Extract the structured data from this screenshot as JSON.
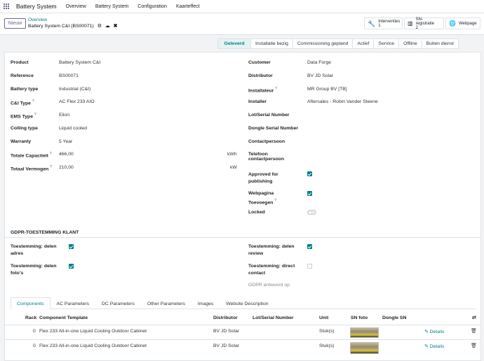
{
  "topbar": {
    "brand": "Battery System",
    "menu": [
      "Overview",
      "Battery System",
      "Configuration",
      "Kaarteffect"
    ]
  },
  "control": {
    "new_label": "Nieuw",
    "breadcrumb": "Overview",
    "record": "Battery System C&I (BS00071)"
  },
  "smart_buttons": [
    {
      "label": "Interventies",
      "count": "1"
    },
    {
      "label": "SN-registratie",
      "count": "2"
    },
    {
      "label": "Webpage",
      "count": ""
    }
  ],
  "statusbar": {
    "stages": [
      "Geleverd",
      "Installatie bezig",
      "Commissioning gepland",
      "Actief",
      "Service",
      "Offline",
      "Buiten dienst"
    ],
    "active": "Geleverd"
  },
  "left_fields": [
    {
      "label": "Product",
      "help": "",
      "value": "Battery System C&I",
      "unit": ""
    },
    {
      "label": "Reference",
      "help": "",
      "value": "BS00071",
      "unit": ""
    },
    {
      "label": "Battery type",
      "help": "",
      "value": "Industrial (C&I)",
      "unit": ""
    },
    {
      "label": "C&I Type",
      "help": "?",
      "value": "AC Flex 233 AIO",
      "unit": ""
    },
    {
      "label": "EMS Type",
      "help": "?",
      "value": "Elion",
      "unit": ""
    },
    {
      "label": "Colling type",
      "help": "",
      "value": "Liquid cooled",
      "unit": ""
    },
    {
      "label": "Warranty",
      "help": "",
      "value": "5 Year",
      "unit": ""
    },
    {
      "label": "Totale Capaciteit",
      "help": "?",
      "value": "466,00",
      "unit": "kWh"
    },
    {
      "label": "Totaal Vermogen",
      "help": "?",
      "value": "210,00",
      "unit": "kW"
    }
  ],
  "right_fields": {
    "customer": {
      "label": "Customer",
      "value": "Data Forge"
    },
    "distributor": {
      "label": "Distributor",
      "value": "BV JD Solar"
    },
    "installateur": {
      "label": "Installateur",
      "help": "?",
      "value": "MR Group BV [TB]"
    },
    "installer": {
      "label": "Installer",
      "value": "Aftersales - Robin Vander Steene"
    },
    "lot": {
      "label": "Lot/Serial Number",
      "value": ""
    },
    "dongle": {
      "label": "Dongle Serial Number",
      "value": ""
    },
    "contact": {
      "label": "Contactpersoon",
      "value": ""
    },
    "telefoon": {
      "label1": "Telefoon",
      "label2": "contactpersoon",
      "value": ""
    },
    "approved": {
      "label1": "Approved for",
      "label2": "publishing",
      "checked": true
    },
    "webpagina": {
      "label1": "Webpagina",
      "label2": "Toevoegen",
      "help": "?",
      "checked": true
    },
    "locked": {
      "label": "Locked",
      "on": false
    }
  },
  "gdpr": {
    "title": "GDPR-TOESTEMMING KLANT",
    "items": [
      {
        "label1": "Toestemming: delen",
        "label2": "adres",
        "checked": true
      },
      {
        "label1": "Toestemming: delen",
        "label2": "foto's",
        "checked": true
      },
      {
        "label1": "Toestemming: delen",
        "label2": "review",
        "checked": true
      },
      {
        "label1": "Toestemming: direct",
        "label2": "contact",
        "checked": false
      }
    ],
    "antwoord": "GDPR antwoord op"
  },
  "tabs": [
    "Components",
    "AC Parameters",
    "DC Parameters",
    "Other Parameters",
    "Images",
    "Website Description"
  ],
  "table": {
    "headers": {
      "rack": "Rack",
      "template": "Component Template",
      "distributor": "Distributor",
      "lot": "Lot/Serial Number",
      "unit": "Unit",
      "sn_foto": "SN foto",
      "dongle": "Dongle SN"
    },
    "rows": [
      {
        "rack": "0",
        "template": "Flex 233 All-in-one Liquid Cooling Outdoor Cabinet",
        "distributor": "BV JD Solar",
        "lot": "",
        "unit": "Stuk(s)",
        "details": "Details"
      },
      {
        "rack": "0",
        "template": "Flex 233 All-in-one Liquid Cooling Outdoor Cabinet",
        "distributor": "BV JD Solar",
        "lot": "",
        "unit": "Stuk(s)",
        "details": "Details"
      }
    ]
  }
}
